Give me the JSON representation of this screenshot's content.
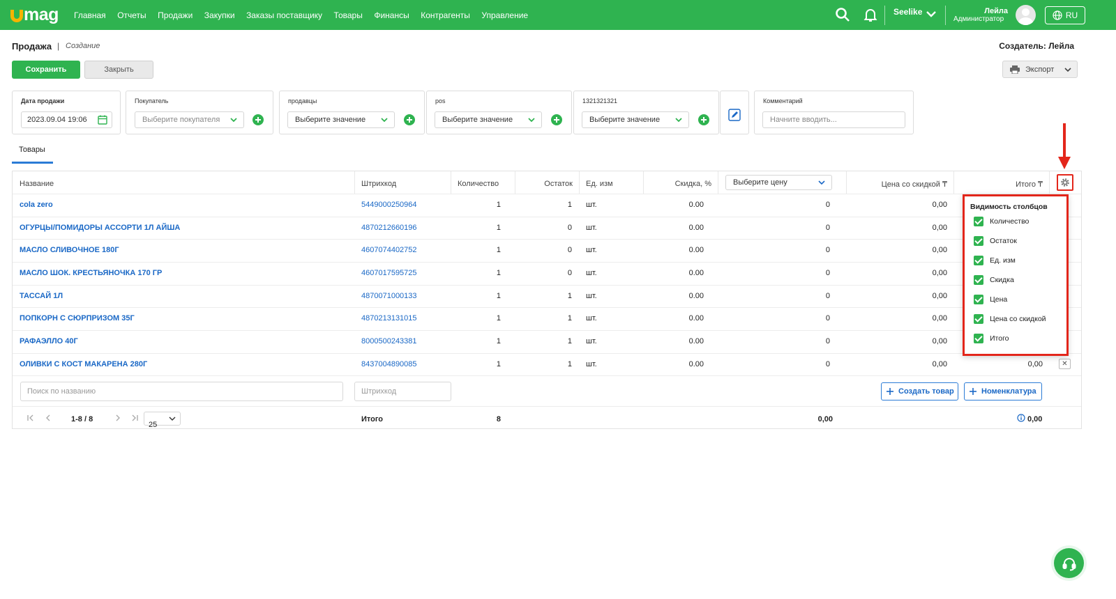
{
  "app": {
    "logo_text": "mag",
    "brand_color": "#2fb350",
    "accent_blue": "#1a68c6",
    "highlight_red": "#e3261b"
  },
  "nav": {
    "items": [
      "Главная",
      "Отчеты",
      "Продажи",
      "Закупки",
      "Заказы поставщику",
      "Товары",
      "Финансы",
      "Контрагенты",
      "Управление"
    ]
  },
  "topbar": {
    "store": "Seelike",
    "user_name": "Лейла",
    "user_role": "Администратор",
    "lang": "RU",
    "icons": [
      "search-icon",
      "bell-icon",
      "chevron-down-icon",
      "avatar",
      "globe-icon"
    ]
  },
  "header": {
    "title": "Продажа",
    "separator": "|",
    "subtitle": "Создание",
    "creator": "Создатель: Лейла"
  },
  "toolbar": {
    "save_label": "Сохранить",
    "close_label": "Закрыть",
    "export_label": "Экспорт"
  },
  "filters": {
    "date": {
      "label": "Дата продажи",
      "value": "2023.09.04 19:06"
    },
    "buyer": {
      "label": "Покупатель",
      "placeholder": "Выберите покупателя"
    },
    "sellers": {
      "label": "продавцы",
      "value": "Выберите значение"
    },
    "pos": {
      "label": "pos",
      "value": "Выберите значение"
    },
    "custom": {
      "label": "1321321321",
      "value": "Выберите значение"
    },
    "comment": {
      "label": "Комментарий",
      "placeholder": "Начните вводить..."
    }
  },
  "tabs": {
    "products": "Товары"
  },
  "table": {
    "headers": {
      "name": "Название",
      "barcode": "Штрихкод",
      "qty": "Количество",
      "stock": "Остаток",
      "unit": "Ед. изм",
      "discount": "Скидка, %",
      "price_select": "Выберите цену",
      "price_discount": "Цена со скидкой ₸",
      "total": "Итого ₸"
    },
    "rows": [
      {
        "name": "cola zero",
        "barcode": "5449000250964",
        "qty": "1",
        "stock": "1",
        "unit": "шт.",
        "discount": "0.00",
        "price": "0",
        "price_discount": "0,00",
        "total": ""
      },
      {
        "name": "ОГУРЦЫ/ПОМИДОРЫ АССОРТИ 1Л АЙША",
        "barcode": "4870212660196",
        "qty": "1",
        "stock": "0",
        "unit": "шт.",
        "discount": "0.00",
        "price": "0",
        "price_discount": "0,00",
        "total": ""
      },
      {
        "name": "МАСЛО СЛИВОЧНОЕ 180Г",
        "barcode": "4607074402752",
        "qty": "1",
        "stock": "0",
        "unit": "шт.",
        "discount": "0.00",
        "price": "0",
        "price_discount": "0,00",
        "total": ""
      },
      {
        "name": "МАСЛО ШОК. КРЕСТЬЯНОЧКА 170 ГР",
        "barcode": "4607017595725",
        "qty": "1",
        "stock": "0",
        "unit": "шт.",
        "discount": "0.00",
        "price": "0",
        "price_discount": "0,00",
        "total": ""
      },
      {
        "name": "ТАССАЙ 1Л",
        "barcode": "4870071000133",
        "qty": "1",
        "stock": "1",
        "unit": "шт.",
        "discount": "0.00",
        "price": "0",
        "price_discount": "0,00",
        "total": ""
      },
      {
        "name": "ПОПКОРН С СЮРПРИЗОМ 35Г",
        "barcode": "4870213131015",
        "qty": "1",
        "stock": "1",
        "unit": "шт.",
        "discount": "0.00",
        "price": "0",
        "price_discount": "0,00",
        "total": ""
      },
      {
        "name": "РАФАЭЛЛО 40Г",
        "barcode": "8000500243381",
        "qty": "1",
        "stock": "1",
        "unit": "шт.",
        "discount": "0.00",
        "price": "0",
        "price_discount": "0,00",
        "total": ""
      },
      {
        "name": "ОЛИВКИ С КОСТ МАКАРЕНА 280Г",
        "barcode": "8437004890085",
        "qty": "1",
        "stock": "1",
        "unit": "шт.",
        "discount": "0.00",
        "price": "0",
        "price_discount": "0,00",
        "total": "0,00"
      }
    ],
    "search_placeholder": "Поиск по названию",
    "barcode_placeholder": "Штрихкод",
    "create_product": "Создать товар",
    "nomenclature": "Номенклатура",
    "remove_symbol": "✕"
  },
  "footer": {
    "range": "1-8 / 8",
    "page_size": "25",
    "total_label": "Итого",
    "total_qty": "8",
    "total_sum": "0,00",
    "grand_total": "0,00"
  },
  "column_popup": {
    "title": "Видимость столбцов",
    "options": [
      "Количество",
      "Остаток",
      "Ед. изм",
      "Скидка",
      "Цена",
      "Цена со скидкой",
      "Итого"
    ]
  }
}
